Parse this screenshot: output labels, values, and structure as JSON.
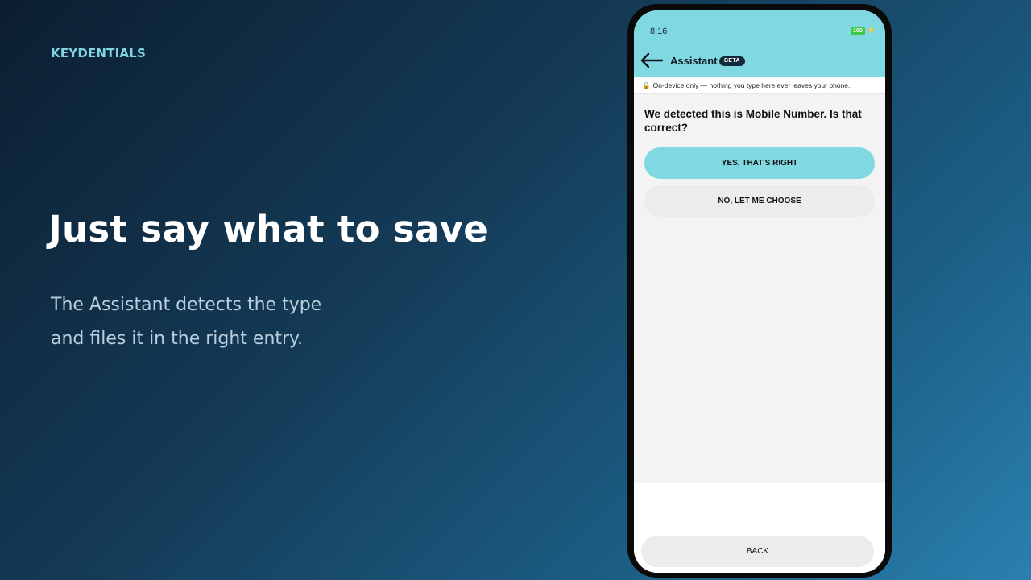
{
  "brand": "KEYDENTIALS",
  "headline": "Just say what to save",
  "subline": [
    "The Assistant detects the type",
    "and files it in the right entry."
  ],
  "phone": {
    "status_bar": {
      "time": "8:16",
      "battery": "100"
    },
    "app_bar": {
      "title": "Assistant",
      "badge": "BETA",
      "back_icon": "arrow-left-icon"
    },
    "privacy_notice": {
      "icon": "lock-icon",
      "text": "On-device only — nothing you type here ever leaves your phone."
    },
    "question": "We detected this is Mobile Number. Is that correct?",
    "buttons": {
      "yes": "YES, THAT'S RIGHT",
      "no": "NO, LET ME CHOOSE",
      "back": "BACK"
    }
  },
  "colors": {
    "accent": "#80d8e2",
    "brand_text": "#7fd6e3",
    "badge_bg": "#132a3c",
    "battery": "#3ec944"
  }
}
